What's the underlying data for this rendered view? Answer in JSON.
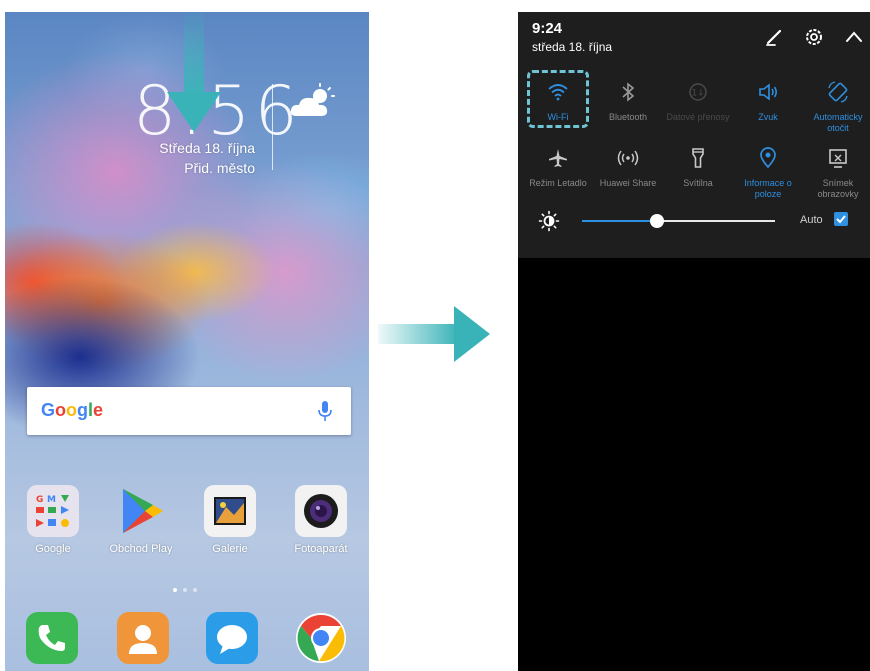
{
  "home_screen": {
    "clock_time": "8:56",
    "date": "Středa 18. října",
    "city": "Přid. město",
    "weather_icon": "partly-cloudy-icon",
    "search": {
      "logo": "Google",
      "mic_icon": "microphone-icon"
    },
    "apps": [
      {
        "label": "Google",
        "icon": "google-folder-icon"
      },
      {
        "label": "Obchod Play",
        "icon": "play-store-icon"
      },
      {
        "label": "Galerie",
        "icon": "gallery-icon"
      },
      {
        "label": "Fotoaparát",
        "icon": "camera-icon"
      }
    ],
    "dock": [
      {
        "icon": "phone-icon",
        "color": "#3cb955"
      },
      {
        "icon": "contacts-icon",
        "color": "#f0953a"
      },
      {
        "icon": "messages-icon",
        "color": "#2b9de8"
      },
      {
        "icon": "chrome-icon",
        "color": "#ffffff"
      }
    ],
    "swipe_arrow_color": "#3ab3b8"
  },
  "notification_panel": {
    "time": "9:24",
    "date": "středa 18. října",
    "header_icons": [
      "edit-icon",
      "settings-icon",
      "collapse-icon"
    ],
    "tiles_row1": [
      {
        "label": "Wi-Fi",
        "icon": "wifi-icon",
        "state": "on"
      },
      {
        "label": "Bluetooth",
        "icon": "bluetooth-icon",
        "state": "off"
      },
      {
        "label": "Datové přenosy",
        "icon": "mobile-data-icon",
        "state": "disabled"
      },
      {
        "label": "Zvuk",
        "icon": "sound-icon",
        "state": "on"
      },
      {
        "label": "Automaticky otočit",
        "icon": "auto-rotate-icon",
        "state": "on"
      }
    ],
    "tiles_row2": [
      {
        "label": "Režim Letadlo",
        "icon": "airplane-icon",
        "state": "off"
      },
      {
        "label": "Huawei Share",
        "icon": "huawei-share-icon",
        "state": "off"
      },
      {
        "label": "Svítilna",
        "icon": "flashlight-icon",
        "state": "off"
      },
      {
        "label": "Informace o poloze",
        "icon": "location-icon",
        "state": "on"
      },
      {
        "label": "Snímek obrazovky",
        "icon": "screenshot-icon",
        "state": "off"
      }
    ],
    "brightness": {
      "level": 0.39,
      "auto_label": "Auto",
      "auto_checked": true
    },
    "accent_color": "#2f8fe0",
    "highlight_color": "#6ec4d4"
  }
}
